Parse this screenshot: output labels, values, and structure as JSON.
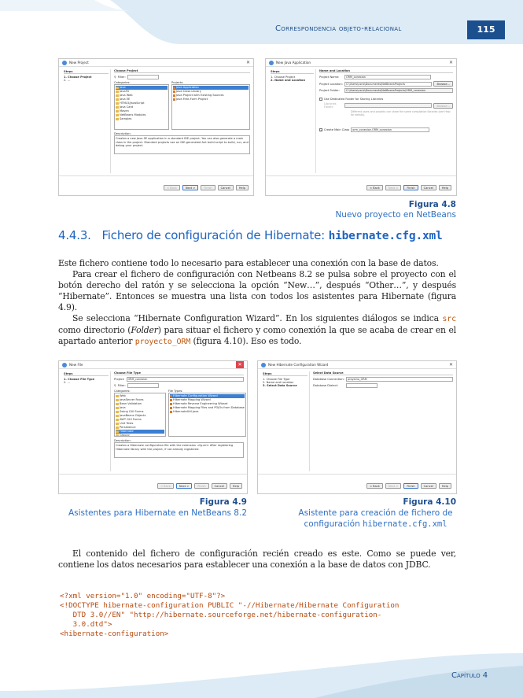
{
  "header": {
    "section_title": "Correspondencia objeto-relacional",
    "page_number": "115"
  },
  "footer": {
    "chapter": "Capítulo 4"
  },
  "fig48": {
    "left": {
      "title": "New Project",
      "steps_head": "Steps",
      "steps": [
        "1.   Choose Project",
        "2.   ..."
      ],
      "main_head": "Choose Project",
      "filter_label": "Filter:",
      "categories_label": "Categories:",
      "projects_label": "Projects:",
      "categories": [
        "Java",
        "JavaFX",
        "Java Web",
        "Java EE",
        "HTML5/JavaScript",
        "Java Card",
        "Maven",
        "NetBeans Modules",
        "Samples"
      ],
      "projects": [
        "Java Application",
        "Java Class Library",
        "Java Project with Existing Sources",
        "Java Free-Form Project"
      ],
      "description_label": "Description:",
      "description": "Creates a new Java SE application in a standard IDE project. You can also generate a main class in the project. Standard projects use an IDE-generated Ant build script to build, run, and debug your project.",
      "buttons": [
        "< Back",
        "Next >",
        "Finish",
        "Cancel",
        "Help"
      ]
    },
    "right": {
      "title": "New Java Application",
      "steps_head": "Steps",
      "steps": [
        "1.   Choose Project",
        "2.   Name and Location"
      ],
      "main_head": "Name and Location",
      "fields": [
        {
          "label": "Project Name:",
          "value": "ORM_conexion"
        },
        {
          "label": "Project Location:",
          "value": "C:\\Users\\usrio\\Documents\\NetBeansProjects"
        },
        {
          "label": "Project Folder:",
          "value": "C:\\Users\\usrio\\Documents\\NetBeansProjects\\ORM_conexion"
        }
      ],
      "browse": "Browse...",
      "dedicated_label": "Use Dedicated Folder for Storing Libraries",
      "libraries_label": "Libraries Folder:",
      "libraries_note": "Different users and projects can share the same compilation libraries (see Help for details).",
      "main_class_label": "Create Main Class",
      "main_class_value": "orm_conexion.ORM_conexion",
      "buttons": [
        "< Back",
        "Next >",
        "Finish",
        "Cancel",
        "Help"
      ]
    },
    "caption_num": "Figura 4.8",
    "caption": "Nuevo proyecto en NetBeans"
  },
  "section": {
    "number": "4.4.3.",
    "title": "Fichero de configuración de Hibernate:",
    "code": "hibernate.cfg.xml"
  },
  "paragraphs": {
    "p1": "Este fichero contiene todo lo necesario para establecer una conexión con la base de datos.",
    "p2": "Para crear el fichero de configuración con Netbeans 8.2 se pulsa sobre el proyecto con el botón derecho del ratón y se selecciona la opción “New…”, después “Other…”, y después “Hibernate”. Entonces se muestra una lista con todos los asistentes para Hibernate (figura 4.9).",
    "p3a": "Se selecciona “Hibernate Configuration Wizard”. En los siguientes diálogos se indica",
    "p3_code1": "src",
    "p3b": "como directorio (",
    "p3_folder": "Folder",
    "p3c": ") para situar el fichero y como conexión la que se acaba de crear en el apartado anterior",
    "p3_code2": "proyecto_ORM",
    "p3d": "(figura 4.10). Eso es todo.",
    "p4": "El contenido del fichero de configuración recién creado es este. Como se puede ver, contiene los datos necesarios para establecer una conexión a la base de datos con JDBC."
  },
  "fig49": {
    "title": "New File",
    "steps_head": "Steps",
    "steps": [
      "1.   Choose File Type",
      "2.   ..."
    ],
    "main_head": "Choose File Type",
    "project_label": "Project:",
    "project_value": "ORM_conexion",
    "filter_label": "Filter:",
    "categories_label": "Categories:",
    "filetypes_label": "File Types:",
    "categories": [
      "Web",
      "JavaServer Faces",
      "Bean Validation",
      "Java",
      "Swing GUI Forms",
      "JavaBeans Objects",
      "AWT GUI Forms",
      "Unit Tests",
      "Persistence",
      "Hibernate",
      "Groovy"
    ],
    "file_types": [
      "Hibernate Configuration Wizard",
      "Hibernate Mapping Wizard",
      "Hibernate Reverse Engineering Wizard",
      "Hibernate Mapping Files and POJOs from Database",
      "HibernateUtil.java"
    ],
    "description_label": "Description:",
    "description": "Creates a Hibernate configuration file with the extension .cfg.xml. After registering Hibernate library with the project, if not already registered.",
    "buttons": [
      "< Back",
      "Next >",
      "Finish",
      "Cancel",
      "Help"
    ],
    "caption_num": "Figura 4.9",
    "caption": "Asistentes para Hibernate en NetBeans 8.2"
  },
  "fig410": {
    "title": "New Hibernate Configuration Wizard",
    "steps_head": "Steps",
    "steps": [
      "1.   Choose File Type",
      "2.   Name and Location",
      "3.   Select Data Source"
    ],
    "main_head": "Select Data Source",
    "conn_label": "Database Connection:",
    "conn_value": "proyecto_ORM",
    "dialect_label": "Database Dialect:",
    "buttons": [
      "< Back",
      "Next >",
      "Finish",
      "Cancel",
      "Help"
    ],
    "caption_num": "Figura 4.10",
    "caption_line1": "Asistente para creación de fichero de",
    "caption_line2": "configuración",
    "caption_code": "hibernate.cfg.xml"
  },
  "code": {
    "l1": "<?xml version=\"1.0\" encoding=\"UTF-8\"?>",
    "l2": "<!DOCTYPE hibernate-configuration PUBLIC \"-//Hibernate/Hibernate Configuration",
    "l3": "   DTD 3.0//EN\" \"http://hibernate.sourceforge.net/hibernate-configuration-",
    "l4": "   3.0.dtd\">",
    "l5": "<hibernate-configuration>"
  }
}
